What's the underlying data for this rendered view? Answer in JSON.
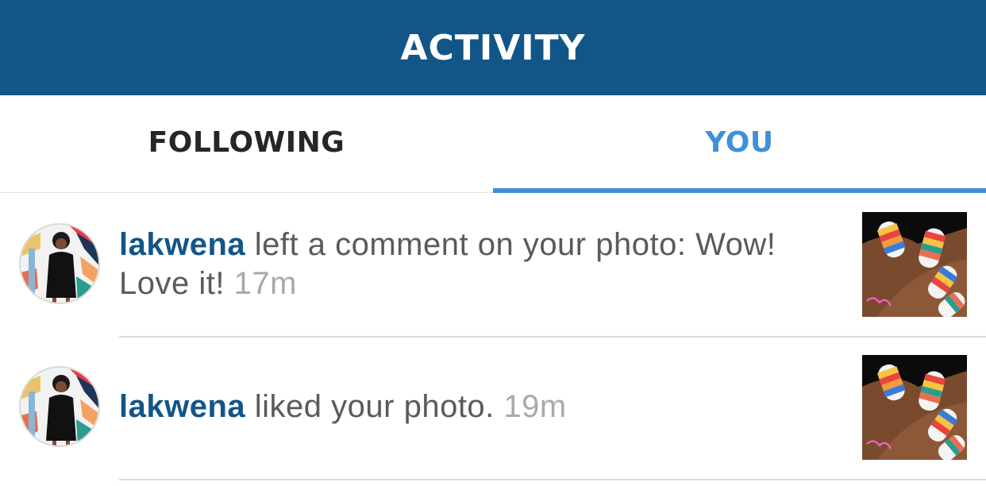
{
  "header": {
    "title": "ACTIVITY"
  },
  "tabs": [
    {
      "label": "FOLLOWING",
      "active": false
    },
    {
      "label": "YOU",
      "active": true
    }
  ],
  "colors": {
    "header_bg": "#125688",
    "active_tab": "#3f8fd9",
    "username": "#125688",
    "body_text": "#5a5a5a",
    "timestamp": "#a9a9a9"
  },
  "notifications": [
    {
      "username": "lakwena",
      "message": " left a comment on your photo: Wow! Love it! ",
      "time": "17m",
      "avatar_icon": "user-avatar-photo",
      "thumbnail_icon": "nail-art-photo"
    },
    {
      "username": "lakwena",
      "message": " liked your photo. ",
      "time": "19m",
      "avatar_icon": "user-avatar-photo",
      "thumbnail_icon": "nail-art-photo"
    }
  ]
}
